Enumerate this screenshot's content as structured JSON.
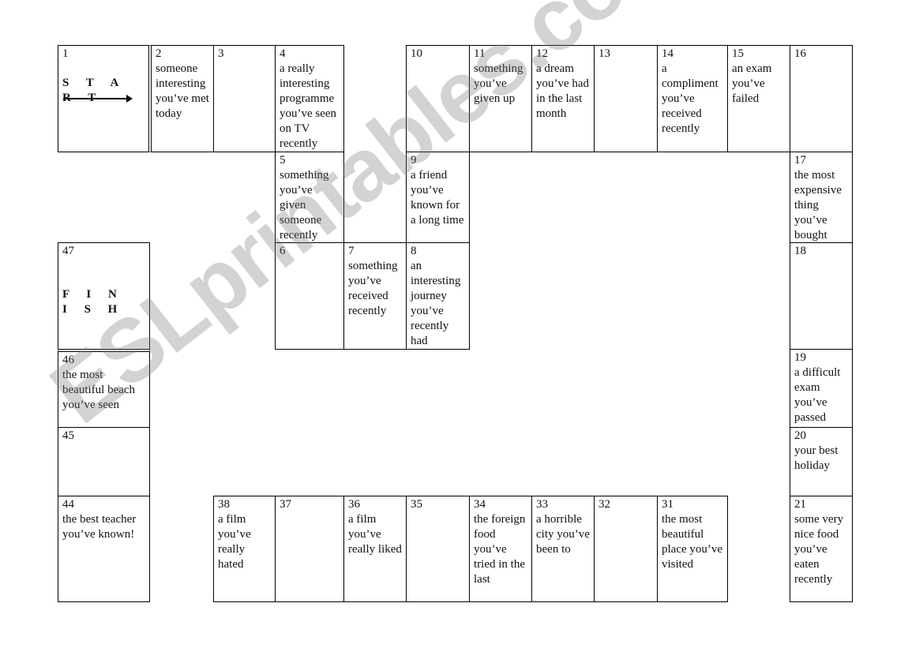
{
  "board": {
    "start_label": "S T A R T",
    "finish_label": "F I N I S H",
    "cells": {
      "1": {
        "n": "1",
        "t": ""
      },
      "2": {
        "n": "2",
        "t": "someone interesting you’ve met today"
      },
      "3": {
        "n": "3",
        "t": ""
      },
      "4": {
        "n": "4",
        "t": "a really interesting programme you’ve seen on TV recently"
      },
      "5": {
        "n": "5",
        "t": "something you’ve given someone recently"
      },
      "6": {
        "n": "6",
        "t": ""
      },
      "7": {
        "n": "7",
        "t": "something you’ve received recently"
      },
      "8": {
        "n": "8",
        "t": "an interesting journey you’ve recently had"
      },
      "9": {
        "n": "9",
        "t": "a friend you’ve known for a long time"
      },
      "10": {
        "n": "10",
        "t": ""
      },
      "11": {
        "n": "11",
        "t": "something you’ve given up"
      },
      "12": {
        "n": "12",
        "t": "a dream you’ve had in the last month"
      },
      "13": {
        "n": "13",
        "t": ""
      },
      "14": {
        "n": "14",
        "t": "a compliment you’ve received recently"
      },
      "15": {
        "n": "15",
        "t": "an exam you’ve failed"
      },
      "16": {
        "n": "16",
        "t": ""
      },
      "17": {
        "n": "17",
        "t": "the most expensive thing you’ve bought"
      },
      "18": {
        "n": "18",
        "t": ""
      },
      "19": {
        "n": "19",
        "t": "a difficult exam you’ve passed"
      },
      "20": {
        "n": "20",
        "t": "your best holiday"
      },
      "21": {
        "n": "21",
        "t": "some very nice food you’ve eaten recently"
      },
      "31": {
        "n": "31",
        "t": "the most beautiful place you’ve visited"
      },
      "32": {
        "n": "32",
        "t": ""
      },
      "33": {
        "n": "33",
        "t": "a horrible city you’ve been to"
      },
      "34": {
        "n": "34",
        "t": "the foreign food you’ve tried in the last"
      },
      "35": {
        "n": "35",
        "t": ""
      },
      "36": {
        "n": "36",
        "t": "a film you’ve really liked"
      },
      "37": {
        "n": "37",
        "t": ""
      },
      "38": {
        "n": "38",
        "t": "a film you’ve really hated"
      },
      "44": {
        "n": "44",
        "t": "the best teacher you’ve known!"
      },
      "45": {
        "n": "45",
        "t": ""
      },
      "46": {
        "n": "46",
        "t": "the most beautiful beach you’ve seen"
      },
      "47": {
        "n": "47",
        "t": ""
      }
    }
  },
  "watermark": "ESLprintables.com"
}
